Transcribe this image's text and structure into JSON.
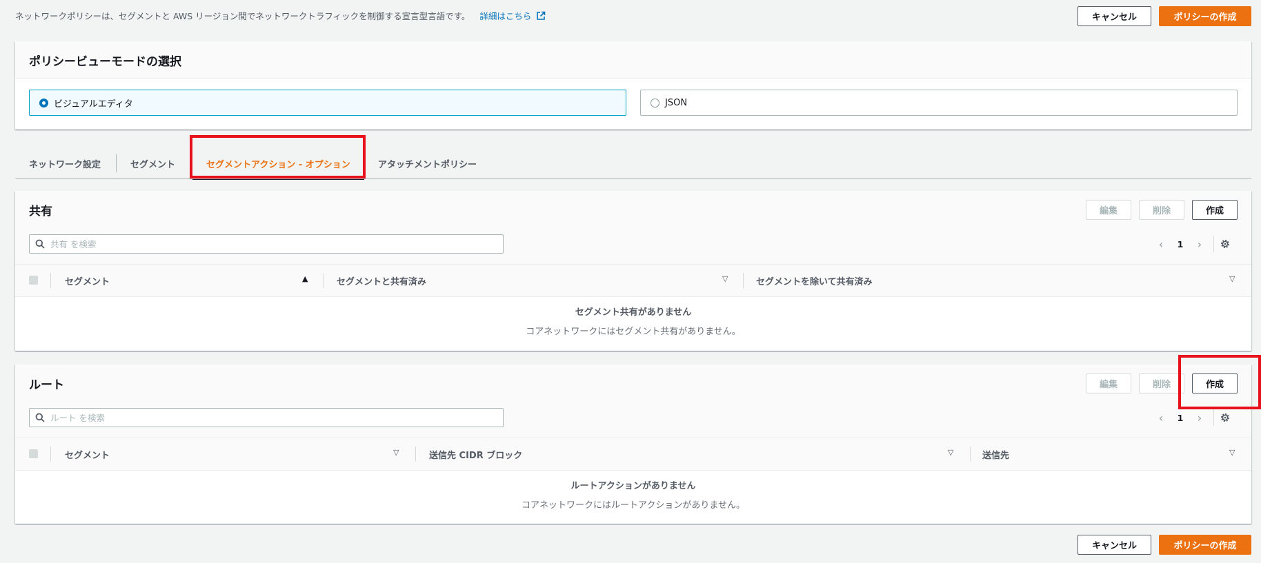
{
  "header": {
    "description": "ネットワークポリシーは、セグメントと AWS リージョン間でネットワークトラフィックを制御する宣言型言語です。",
    "learn_more": "詳細はこちら",
    "cancel": "キャンセル",
    "create_policy": "ポリシーの作成"
  },
  "view_mode": {
    "title": "ポリシービューモードの選択",
    "options": [
      {
        "label": "ビジュアルエディタ",
        "selected": true
      },
      {
        "label": "JSON",
        "selected": false
      }
    ]
  },
  "tabs": [
    {
      "label": "ネットワーク設定",
      "active": false
    },
    {
      "label": "セグメント",
      "active": false
    },
    {
      "label": "セグメントアクション - オプション",
      "active": true
    },
    {
      "label": "アタッチメントポリシー",
      "active": false
    }
  ],
  "share": {
    "title": "共有",
    "edit": "編集",
    "delete": "削除",
    "create": "作成",
    "search_placeholder": "共有 を検索",
    "page": "1",
    "columns": [
      "セグメント",
      "セグメントと共有済み",
      "セグメントを除いて共有済み"
    ],
    "empty_title": "セグメント共有がありません",
    "empty_desc": "コアネットワークにはセグメント共有がありません。"
  },
  "route": {
    "title": "ルート",
    "edit": "編集",
    "delete": "削除",
    "create": "作成",
    "search_placeholder": "ルート を検索",
    "page": "1",
    "columns": [
      "セグメント",
      "送信先 CIDR ブロック",
      "送信先"
    ],
    "empty_title": "ルートアクションがありません",
    "empty_desc": "コアネットワークにはルートアクションがありません。"
  },
  "footer": {
    "cancel": "キャンセル",
    "create_policy": "ポリシーの作成"
  },
  "colors": {
    "accent": "#ec7211",
    "link": "#0073bb",
    "highlight": "#e8111b"
  }
}
